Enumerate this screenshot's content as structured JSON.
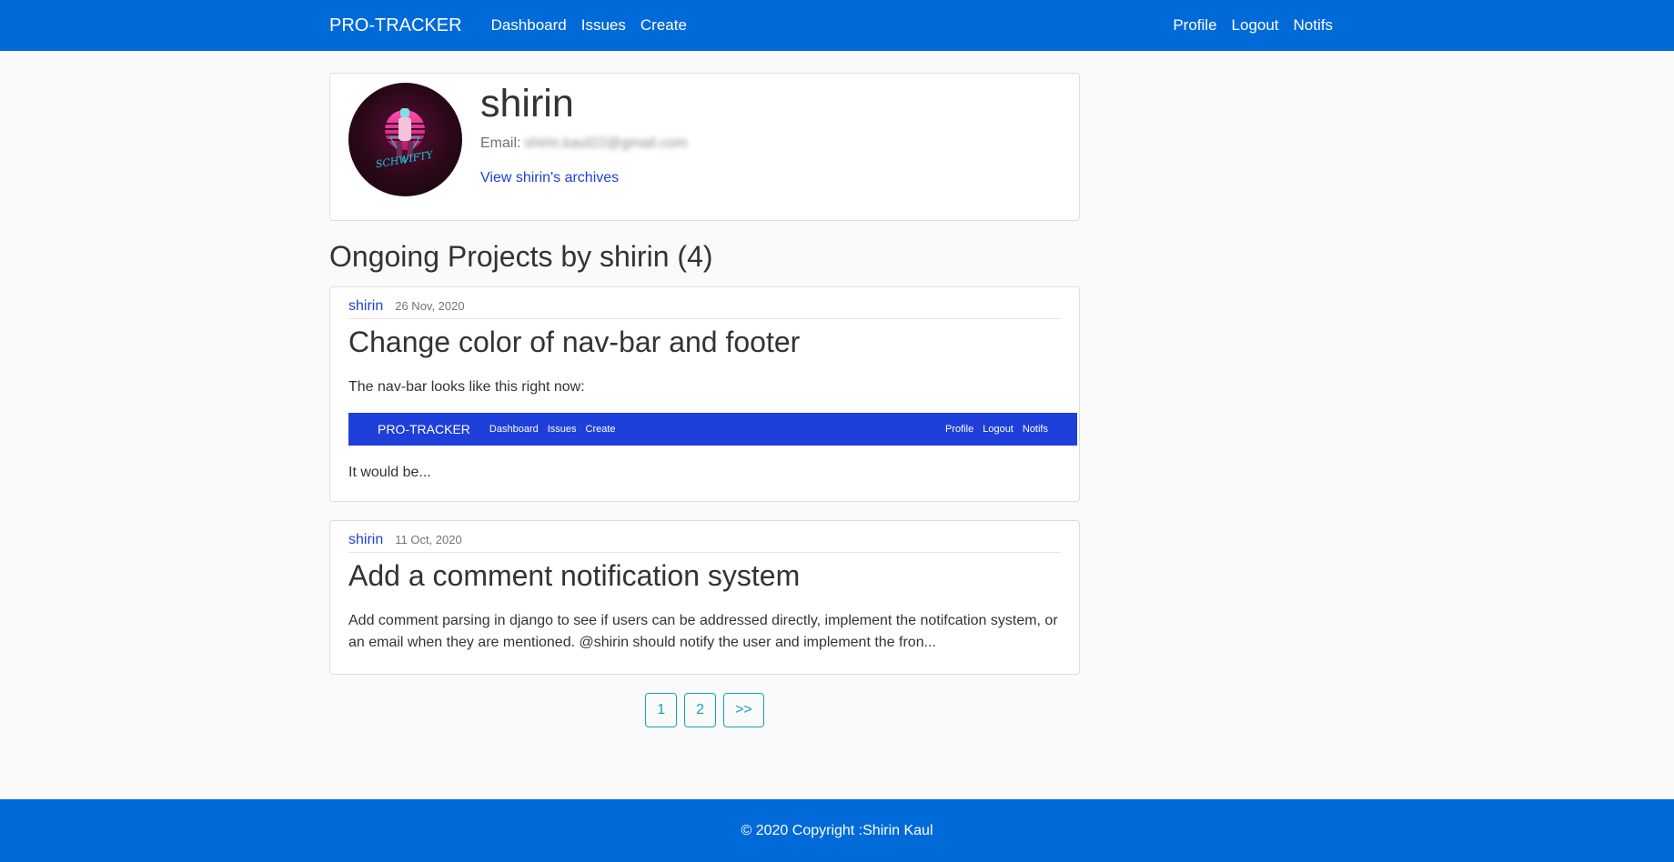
{
  "navbar": {
    "brand": "PRO-TRACKER",
    "left_links": [
      "Dashboard",
      "Issues",
      "Create"
    ],
    "right_links": [
      "Profile",
      "Logout",
      "Notifs"
    ]
  },
  "profile": {
    "username": "shirin",
    "email_label": "Email:",
    "email_value": "shirin.kaul22@gmail.com",
    "archives_link": "View shirin's archives"
  },
  "section": {
    "title": "Ongoing Projects by shirin (4)"
  },
  "posts": [
    {
      "author": "shirin",
      "date": "26 Nov, 2020",
      "title": "Change color of nav-bar and footer",
      "text_before": "The nav-bar looks like this right now:",
      "embedded_nav": {
        "brand": "PRO-TRACKER",
        "left_links": [
          "Dashboard",
          "Issues",
          "Create"
        ],
        "right_links": [
          "Profile",
          "Logout",
          "Notifs"
        ]
      },
      "text_after": "It would be..."
    },
    {
      "author": "shirin",
      "date": "11 Oct, 2020",
      "title": "Add a comment notification system",
      "text": "Add comment parsing in django to see if users can be addressed directly, implement the notifcation system, or an email when they are mentioned. @shirin should notify the user and implement the fron..."
    }
  ],
  "pagination": [
    "1",
    "2",
    ">>"
  ],
  "footer": {
    "text": "© 2020 Copyright :Shirin Kaul"
  },
  "colors": {
    "navbar_bg": "#006ad9",
    "link": "#1e3fd9",
    "embedded_nav_bg": "#1e3fd9",
    "pagination_accent": "#17a2b8"
  },
  "avatar": {
    "icon": "avatar-image",
    "caption": "SCHWIFTY"
  }
}
